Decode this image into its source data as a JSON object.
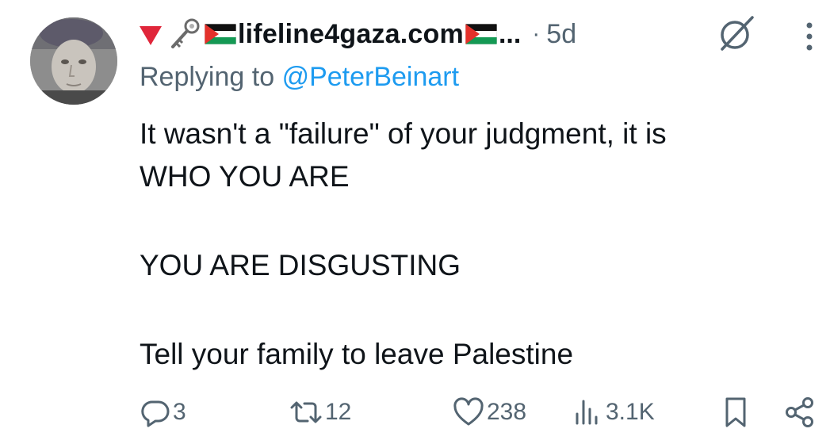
{
  "tweet": {
    "display_name": "lifeline4gaza.com",
    "truncation": "...",
    "separator": "·",
    "time_ago": "5d",
    "reply_prefix": "Replying to",
    "reply_handle": "@PeterBeinart",
    "body_lines": [
      "It wasn't a \"failure\" of your judgment, it is",
      "WHO YOU ARE",
      "YOU ARE DISGUSTING",
      "Tell your family to leave Palestine"
    ]
  },
  "header_icons": [
    "red-triangle-icon",
    "old-key-icon",
    "palestine-flag-icon",
    "palestine-flag-icon"
  ],
  "actions": {
    "replies": "3",
    "reposts": "12",
    "likes": "238",
    "views": "3.1K"
  },
  "colors": {
    "text": "#0f1419",
    "secondary": "#536471",
    "link": "#1d9bf0",
    "triangle": "#e0263a"
  }
}
